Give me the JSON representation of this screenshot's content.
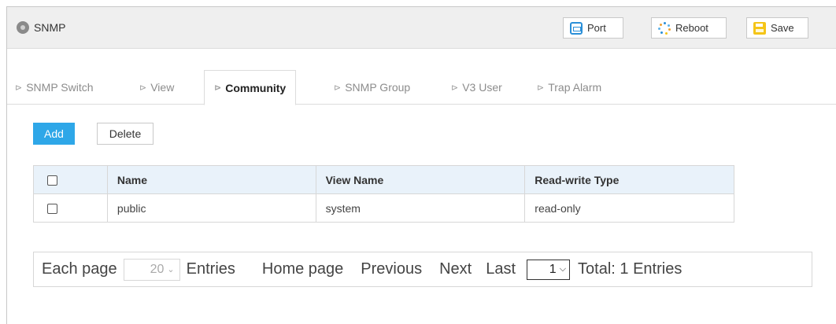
{
  "header": {
    "title": "SNMP",
    "port_label": "Port",
    "reboot_label": "Reboot",
    "save_label": "Save"
  },
  "tabs": [
    {
      "label": "SNMP Switch"
    },
    {
      "label": "View"
    },
    {
      "label": "Community"
    },
    {
      "label": "SNMP Group"
    },
    {
      "label": "V3 User"
    },
    {
      "label": "Trap Alarm"
    }
  ],
  "active_tab": "Community",
  "actions": {
    "add_label": "Add",
    "delete_label": "Delete"
  },
  "table": {
    "columns": [
      "Name",
      "View Name",
      "Read-write Type"
    ],
    "rows": [
      {
        "name": "public",
        "view_name": "system",
        "rw_type": "read-only"
      }
    ]
  },
  "pager": {
    "each_page_label": "Each page",
    "per_page_value": "20",
    "entries_label": "Entries",
    "home_label": "Home page",
    "previous_label": "Previous",
    "next_label": "Next",
    "last_label": "Last",
    "page_value": "1",
    "total_label": "Total: 1 Entries"
  },
  "colors": {
    "accent": "#2ea7e8",
    "header_row": "#e9f2fa",
    "titlebar": "#efefef"
  }
}
